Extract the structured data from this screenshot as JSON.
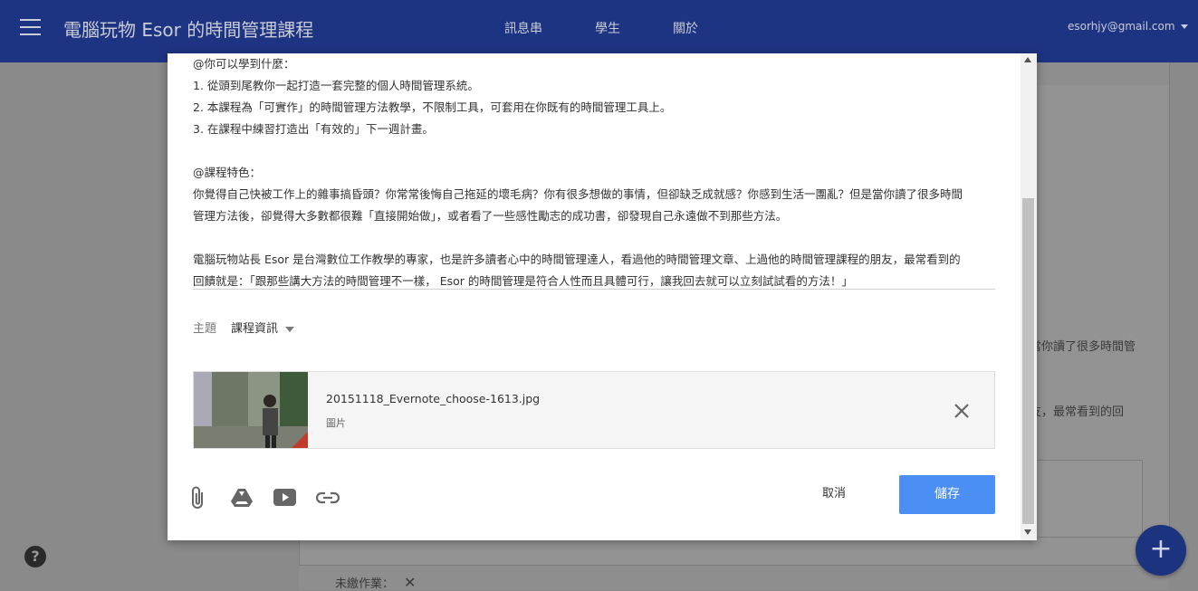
{
  "header": {
    "course_title": "電腦玩物 Esor 的時間管理課程",
    "nav": [
      "訊息串",
      "學生",
      "關於"
    ],
    "account_email": "esorhjy@gmail.com"
  },
  "background": {
    "snippet_1": "當你讀了很多時間管",
    "snippet_2": "友，最常看到的回",
    "bottom_label": "未繳作業：",
    "close_glyph": "✕"
  },
  "help_label": "?",
  "fab_label": "+",
  "dialog": {
    "body_lines": [
      "@你可以學到什麼：",
      "1. 從頭到尾教你一起打造一套完整的個人時間管理系統。",
      "2. 本課程為「可實作」的時間管理方法教學，不限制工具，可套用在你既有的時間管理工具上。",
      "3. 在課程中練習打造出「有效的」下一週計畫。",
      "",
      "@課程特色：",
      "你覺得自己快被工作上的雜事搞昏頭？你常常後悔自己拖延的壞毛病？你有很多想做的事情，但卻缺乏成就感？你感到生活一團亂？但是當你讀了很多時間",
      "管理方法後，卻覺得大多數都很難「直接開始做」，或者看了一些感性勵志的成功書，卻發現自己永遠做不到那些方法。",
      "",
      "電腦玩物站長 Esor 是台灣數位工作教學的專家，也是許多讀者心中的時間管理達人，看過他的時間管理文章、上過他的時間管理課程的朋友，最常看到的",
      "回饋就是：「跟那些講大方法的時間管理不一樣， Esor 的時間管理是符合人性而且具體可行，讓我回去就可以立刻試試看的方法！」"
    ],
    "topic_label": "主題",
    "topic_value": "課程資訊",
    "attachment": {
      "file_name": "20151118_Evernote_choose-1613.jpg",
      "file_type": "圖片"
    },
    "cancel_label": "取消",
    "save_label": "儲存"
  },
  "icons": [
    "menu-icon",
    "paperclip-icon",
    "google-drive-icon",
    "youtube-icon",
    "link-icon",
    "close-icon",
    "help-icon",
    "add-icon"
  ]
}
